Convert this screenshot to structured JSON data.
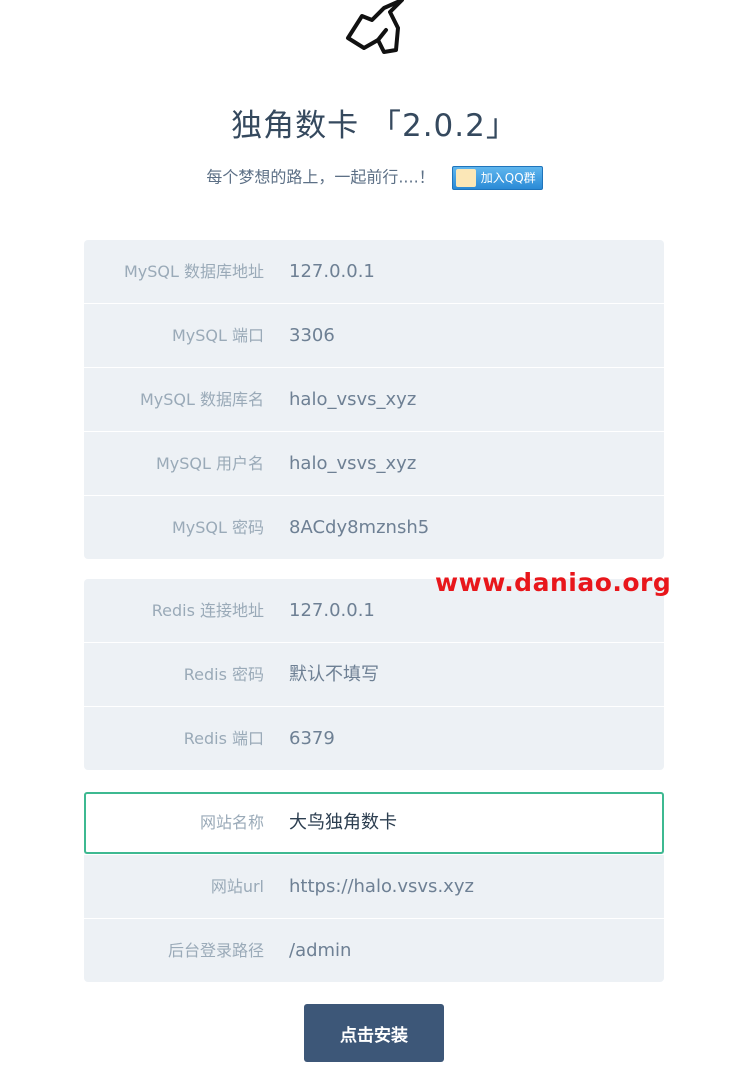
{
  "header": {
    "title": "独角数卡 「2.0.2」",
    "subtitle": "每个梦想的路上，一起前行....！",
    "qq_badge_label": "加入QQ群"
  },
  "mysql": [
    {
      "label": "MySQL 数据库地址",
      "value": "127.0.0.1"
    },
    {
      "label": "MySQL 端口",
      "value": "3306"
    },
    {
      "label": "MySQL 数据库名",
      "value": "halo_vsvs_xyz"
    },
    {
      "label": "MySQL 用户名",
      "value": "halo_vsvs_xyz"
    },
    {
      "label": "MySQL 密码",
      "value": "8ACdy8mznsh5"
    }
  ],
  "redis": [
    {
      "label": "Redis 连接地址",
      "value": "127.0.0.1"
    },
    {
      "label": "Redis 密码",
      "value": "默认不填写"
    },
    {
      "label": "Redis 端口",
      "value": "6379"
    }
  ],
  "site": [
    {
      "label": "网站名称",
      "value": "大鸟独角数卡"
    },
    {
      "label": "网站url",
      "value": "https://halo.vsvs.xyz"
    },
    {
      "label": "后台登录路径",
      "value": "/admin"
    }
  ],
  "watermark": "www.daniao.org",
  "install_button_label": "点击安装",
  "colors": {
    "accent_border": "#3eb991",
    "button_bg": "#3d5778",
    "card_bg": "#edf1f5",
    "watermark": "#e8161b"
  },
  "icons": {
    "logo": "unicorn-logo-icon",
    "qq": "qq-group-icon"
  }
}
